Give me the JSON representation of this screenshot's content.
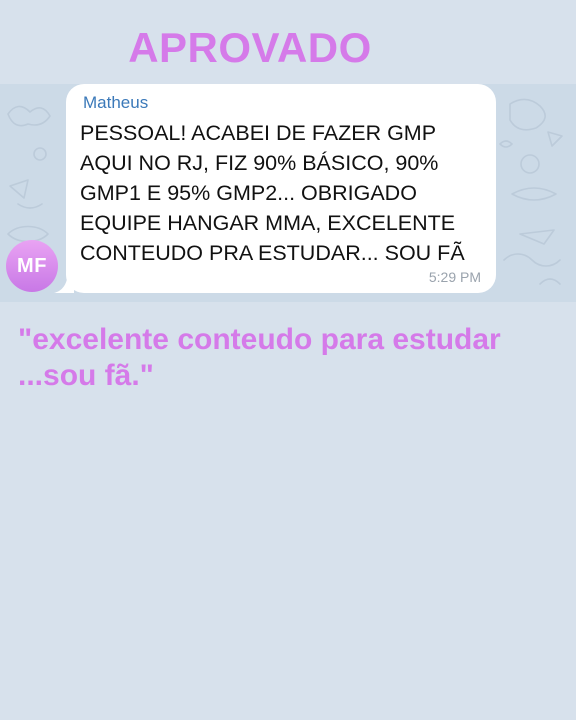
{
  "headline": "APROVADO",
  "chat": {
    "avatar_initials": "MF",
    "sender": "Matheus",
    "message_lines": [
      "PESSOAL! ACABEI DE FAZER GMP",
      "AQUI NO RJ, FIZ 90% BÁSICO, 90%",
      "GMP1 E 95% GMP2... OBRIGADO",
      "EQUIPE HANGAR MMA, EXCELENTE",
      "CONTEUDO PRA ESTUDAR... SOU FÃ"
    ],
    "time": "5:29 PM"
  },
  "quote_lines": [
    "\"excelente conteudo para estudar",
    "...sou fã.\""
  ],
  "colors": {
    "accent": "#d57ae9",
    "background": "#d7e1ec",
    "chat_background": "#ccdae7",
    "sender_name": "#3b79b9",
    "bubble": "#ffffff"
  },
  "icons": [
    "chat-wallpaper-doodles",
    "avatar"
  ]
}
